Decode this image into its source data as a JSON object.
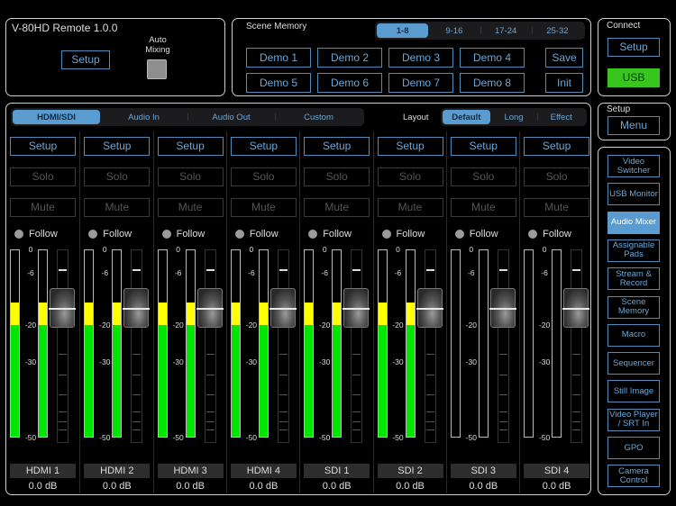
{
  "app": {
    "title": "V-80HD Remote 1.0.0",
    "setup_label": "Setup",
    "auto_mixing_label": "Auto\nMixing"
  },
  "scene_memory": {
    "title": "Scene Memory",
    "banks": [
      "1-8",
      "9-16",
      "17-24",
      "25-32"
    ],
    "selected_bank": "1-8",
    "scenes": [
      "Demo 1",
      "Demo 2",
      "Demo 3",
      "Demo 4",
      "Demo 5",
      "Demo 6",
      "Demo 7",
      "Demo 8"
    ],
    "save_label": "Save",
    "init_label": "Init"
  },
  "connect": {
    "title": "Connect",
    "setup_label": "Setup",
    "usb_label": "USB"
  },
  "setup_menu": {
    "title": "Setup",
    "menu_label": "Menu"
  },
  "mixer": {
    "tabs": [
      "HDMI/SDI",
      "Audio In",
      "Audio Out",
      "Custom"
    ],
    "selected_tab": "HDMI/SDI",
    "layout_label": "Layout",
    "layouts": [
      "Default",
      "Long",
      "Effect"
    ],
    "selected_layout": "Default",
    "scale_labels": [
      "0",
      "-6",
      "-20",
      "-30",
      "-50"
    ],
    "channel_setup": "Setup",
    "channel_solo": "Solo",
    "channel_mute": "Mute",
    "channel_follow": "Follow",
    "channels": [
      {
        "name": "HDMI 1",
        "level": "0.0 dB",
        "meter_db": -14
      },
      {
        "name": "HDMI 2",
        "level": "0.0 dB",
        "meter_db": -14
      },
      {
        "name": "HDMI 3",
        "level": "0.0 dB",
        "meter_db": -14
      },
      {
        "name": "HDMI 4",
        "level": "0.0 dB",
        "meter_db": -14
      },
      {
        "name": "SDI 1",
        "level": "0.0 dB",
        "meter_db": -14
      },
      {
        "name": "SDI 2",
        "level": "0.0 dB",
        "meter_db": -14
      },
      {
        "name": "SDI 3",
        "level": "0.0 dB",
        "meter_db": null
      },
      {
        "name": "SDI 4",
        "level": "0.0 dB",
        "meter_db": null
      }
    ]
  },
  "nav": {
    "items": [
      "Video Switcher",
      "USB Monitor",
      "Audio Mixer",
      "Assignable Pads",
      "Stream & Record",
      "Scene Memory",
      "Macro",
      "Sequencer",
      "Still Image",
      "Video Player / SRT In",
      "GPO",
      "Camera Control"
    ],
    "selected": "Audio Mixer"
  },
  "colors": {
    "accent": "#5a9bd0",
    "usb_active": "#38c61e",
    "meter_green": "#00e600",
    "meter_yellow": "#ffff00"
  }
}
